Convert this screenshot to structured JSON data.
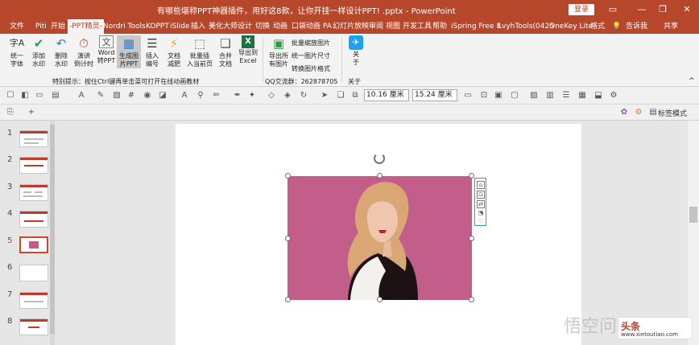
{
  "window": {
    "title": "有哪些堪称PPT神器插件，用好这8款，让你开挂一样设计PPT! .pptx  -  PowerPoint",
    "login_label": "登录",
    "controls": [
      "▭",
      "—",
      "❐",
      "✕"
    ]
  },
  "menu": {
    "tabs": [
      "文件",
      "Piti",
      "开始",
      "-PPT精灵-",
      "Nordri Tools",
      "KOPPT",
      "iSlide",
      "插入",
      "美化大师",
      "设计",
      "切换",
      "动画",
      "口袋动画 PA",
      "幻灯片放映",
      "审阅",
      "视图",
      "开发工具",
      "帮助",
      "iSpring Free 8",
      "LvyhTools(0425",
      "OneKey Lite",
      "格式"
    ],
    "tell_me": "告诉我",
    "share": "共享"
  },
  "ribbon": {
    "buttons": [
      {
        "label1": "统一",
        "label2": "字体",
        "icon": "font-icon",
        "glyph": "字A"
      },
      {
        "label1": "添加",
        "label2": "水印",
        "icon": "check-icon",
        "glyph": "✔"
      },
      {
        "label1": "删除",
        "label2": "水印",
        "icon": "undo-icon",
        "glyph": "↶"
      },
      {
        "label1": "演讲",
        "label2": "倒计时",
        "icon": "timer-icon",
        "glyph": "⏱"
      },
      {
        "label1": "Word",
        "label2": "转PPT",
        "icon": "word-icon",
        "glyph": "文"
      },
      {
        "label1": "生成图",
        "label2": "片PPT",
        "icon": "image-ppt-icon",
        "glyph": "▦"
      },
      {
        "label1": "插入",
        "label2": "编号",
        "icon": "numbering-icon",
        "glyph": "☰"
      },
      {
        "label1": "文档",
        "label2": "减肥",
        "icon": "lightning-icon",
        "glyph": "⚡"
      },
      {
        "label1": "批量插",
        "label2": "入当前页",
        "icon": "batch-insert-icon",
        "glyph": "⬚"
      },
      {
        "label1": "合并",
        "label2": "文档",
        "icon": "merge-icon",
        "glyph": "❏"
      },
      {
        "label1": "导出到",
        "label2": "Excel",
        "icon": "excel-icon",
        "glyph": "X"
      },
      {
        "label1": "导出所",
        "label2": "有图片",
        "icon": "export-images-icon",
        "glyph": "▣"
      },
      {
        "label1": "关",
        "label2": "于",
        "icon": "twitter-bird-icon",
        "glyph": "✈"
      }
    ],
    "small_buttons": [
      "批量缩放图片",
      "统一图片尺寸",
      "转换图片格式"
    ],
    "hint": "特别提示：按住Ctrl键再单击菜可打开在线动画教材",
    "qq": "QQ交流群：262878705",
    "about_group": "关于"
  },
  "toolbar": {
    "width_value": "10.16 厘米",
    "height_value": "15.24 厘米",
    "label_mode": "标签模式"
  },
  "thumbnails": {
    "numbers": [
      "1",
      "2",
      "3",
      "4",
      "5",
      "6",
      "7",
      "8"
    ],
    "active_index": 4
  },
  "colors": {
    "accent": "#b7472a",
    "photo_bg": "#c35d8a"
  },
  "watermark": {
    "text": "悟空问答",
    "logo": "头条",
    "url": "www.xietoutiao.com"
  }
}
